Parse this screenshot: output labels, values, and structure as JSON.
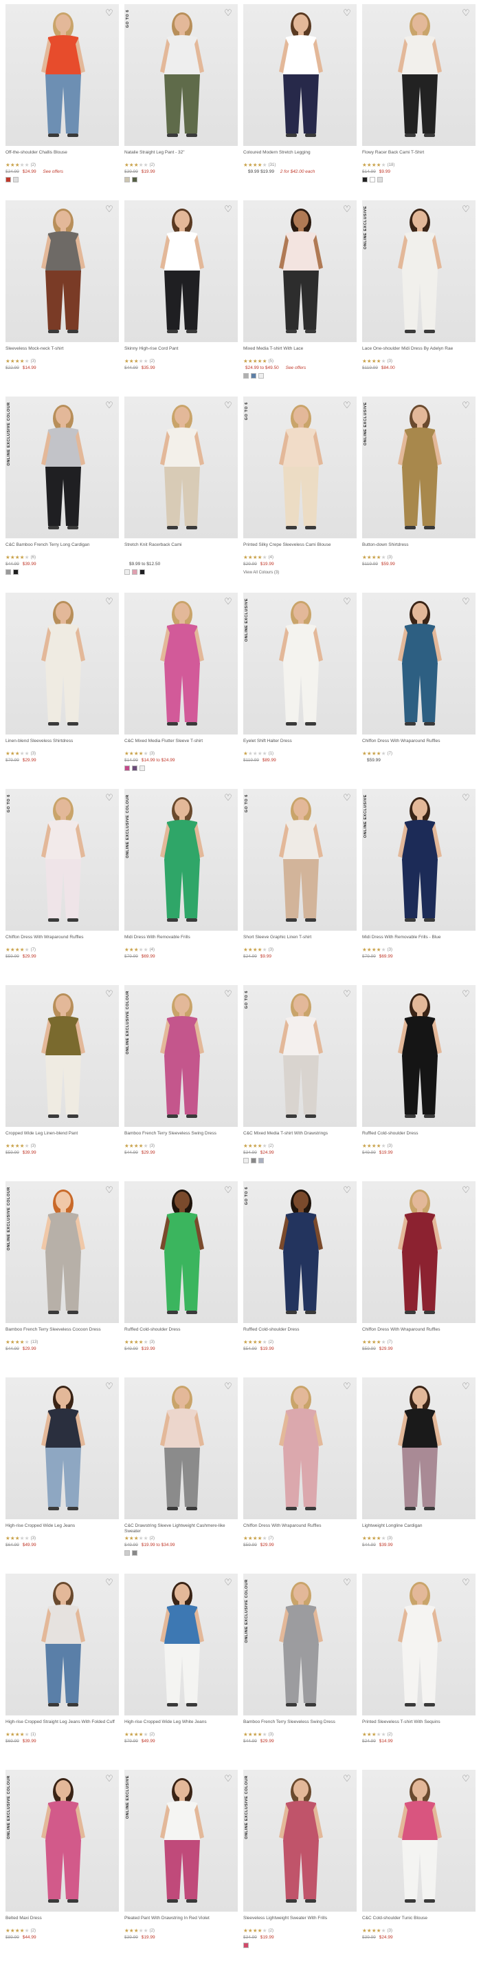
{
  "products": [
    {
      "name": "Off-the-shoulder Challis Blouse",
      "rating": 3,
      "reviews": "(2)",
      "orig": "$34.99",
      "sale": "$24.99",
      "price": "",
      "offer": "See offers",
      "alt": "",
      "badge": "",
      "swatches": [
        "#c0392b",
        "#dddddd"
      ],
      "view_all": "",
      "figure": {
        "top": "#e74c2c",
        "bottom": "#6d8fb3",
        "hair": "#c9a46a",
        "skin": "#e3b899"
      }
    },
    {
      "name": "Natalie Straight Leg Pant - 32\"",
      "rating": 3,
      "reviews": "(2)",
      "orig": "$39.99",
      "sale": "$19.99",
      "price": "",
      "offer": "",
      "alt": "",
      "badge": "GO TO 6",
      "swatches": [
        "#ccc5b0",
        "#555f44"
      ],
      "view_all": "",
      "figure": {
        "top": "#eeeeee",
        "bottom": "#5f6b4a",
        "hair": "#b88f5a",
        "skin": "#e3b899"
      }
    },
    {
      "name": "Coloured Modern Stretch Legging",
      "rating": 4,
      "reviews": "(31)",
      "orig": "",
      "sale": "",
      "price": "$9.99 $19.99",
      "offer": "",
      "alt": "2 for $42.00 each",
      "badge": "",
      "swatches": [],
      "view_all": "",
      "figure": {
        "top": "#ffffff",
        "bottom": "#27294a",
        "hair": "#5a3a22",
        "skin": "#e3b899"
      }
    },
    {
      "name": "Flowy Racer Back Cami T-Shirt",
      "rating": 4,
      "reviews": "(18)",
      "orig": "$14.99",
      "sale": "$9.99",
      "price": "",
      "offer": "",
      "alt": "",
      "badge": "",
      "swatches": [
        "#222222",
        "#ffffff",
        "#dddddd"
      ],
      "view_all": "",
      "figure": {
        "top": "#f2f0ec",
        "bottom": "#222222",
        "hair": "#c9a46a",
        "skin": "#e3b899"
      }
    },
    {
      "name": "Sleeveless Mock-neck T-shirt",
      "rating": 4,
      "reviews": "(3)",
      "orig": "$22.99",
      "sale": "$14.99",
      "price": "",
      "offer": "",
      "alt": "",
      "badge": "",
      "swatches": [],
      "view_all": "",
      "figure": {
        "top": "#6e6a66",
        "bottom": "#7a3b26",
        "hair": "#b88f5a",
        "skin": "#e3b899"
      }
    },
    {
      "name": "Skinny High-rise Cord Pant",
      "rating": 3,
      "reviews": "(2)",
      "orig": "$44.99",
      "sale": "$35.99",
      "price": "",
      "offer": "",
      "alt": "",
      "badge": "",
      "swatches": [],
      "view_all": "",
      "figure": {
        "top": "#ffffff",
        "bottom": "#1f1f22",
        "hair": "#5a3a22",
        "skin": "#e3b899"
      }
    },
    {
      "name": "Mixed Media T-shirt With Lace",
      "rating": 5,
      "reviews": "(5)",
      "orig": "",
      "sale": "$24.99 to $49.50",
      "price": "",
      "offer": "See offers",
      "alt": "",
      "badge": "",
      "swatches": [
        "#b0b0b0",
        "#5d7fa6",
        "#eeeeee"
      ],
      "view_all": "",
      "figure": {
        "top": "#f3e4e0",
        "bottom": "#2d2d2d",
        "hair": "#2a1a10",
        "skin": "#b07a55"
      }
    },
    {
      "name": "Lace One-shoulder Midi Dress By Adelyn Rae",
      "rating": 4,
      "reviews": "(3)",
      "orig": "$119.99",
      "sale": "$84.00",
      "price": "",
      "offer": "",
      "alt": "",
      "badge": "ONLINE EXCLUSIVE",
      "swatches": [],
      "view_all": "",
      "figure": {
        "top": "#f1f0ec",
        "bottom": "#f1f0ec",
        "hair": "#3a2416",
        "skin": "#e3b899"
      }
    },
    {
      "name": "C&C Bamboo French Terry Long Cardigan",
      "rating": 4,
      "reviews": "(6)",
      "orig": "$44.99",
      "sale": "$39.99",
      "price": "",
      "offer": "",
      "alt": "",
      "badge": "ONLINE EXCLUSIVE COLOUR",
      "swatches": [
        "#9a9a9a",
        "#1f1f1f"
      ],
      "view_all": "",
      "figure": {
        "top": "#c2c3c8",
        "bottom": "#1f1f22",
        "hair": "#b88f5a",
        "skin": "#e3b899"
      }
    },
    {
      "name": "Stretch Knit Racerback Cami",
      "rating": 0,
      "reviews": "",
      "orig": "",
      "sale": "",
      "price": "$9.99 to $12.50",
      "offer": "",
      "alt": "",
      "badge": "",
      "swatches": [
        "#eeeeee",
        "#e0a0b0",
        "#1f1f22"
      ],
      "view_all": "",
      "figure": {
        "top": "#f3f0ea",
        "bottom": "#d8cbb6",
        "hair": "#c9a46a",
        "skin": "#e3b899"
      }
    },
    {
      "name": "Printed Silky Crepe Sleeveless Cami Blouse",
      "rating": 4,
      "reviews": "(4)",
      "orig": "$29.99",
      "sale": "$19.99",
      "price": "",
      "offer": "",
      "alt": "",
      "badge": "GO TO 6",
      "swatches": [],
      "view_all": "View All Colours (3)",
      "figure": {
        "top": "#f1dcc8",
        "bottom": "#ecdcc4",
        "hair": "#c9a46a",
        "skin": "#e3b899"
      }
    },
    {
      "name": "Button-down Shirtdress",
      "rating": 4,
      "reviews": "(3)",
      "orig": "$119.99",
      "sale": "$59.99",
      "price": "",
      "offer": "",
      "alt": "",
      "badge": "ONLINE EXCLUSIVE",
      "swatches": [],
      "view_all": "",
      "figure": {
        "top": "#a8884c",
        "bottom": "#a8884c",
        "hair": "#6a4a2e",
        "skin": "#e3b899"
      }
    },
    {
      "name": "Linen-blend Sleeveless Shirtdress",
      "rating": 3,
      "reviews": "(3)",
      "orig": "$79.99",
      "sale": "$29.99",
      "price": "",
      "offer": "",
      "alt": "",
      "badge": "",
      "swatches": [],
      "view_all": "",
      "figure": {
        "top": "#efebe2",
        "bottom": "#efebe2",
        "hair": "#b88f5a",
        "skin": "#e3b899"
      }
    },
    {
      "name": "C&C Mixed Media Flutter Sleeve T-shirt",
      "rating": 4,
      "reviews": "(3)",
      "orig": "$14.99",
      "sale": "$14.99 to $24.99",
      "price": "",
      "offer": "",
      "alt": "",
      "badge": "",
      "swatches": [
        "#c24a8a",
        "#6a4d7a",
        "#eeeeee"
      ],
      "view_all": "",
      "figure": {
        "top": "#d25a99",
        "bottom": "#d25a99",
        "hair": "#c9a46a",
        "skin": "#e3b899"
      }
    },
    {
      "name": "Eyelet Shift Halter Dress",
      "rating": 1,
      "reviews": "(1)",
      "orig": "$119.99",
      "sale": "$89.99",
      "price": "",
      "offer": "",
      "alt": "",
      "badge": "ONLINE EXCLUSIVE",
      "swatches": [],
      "view_all": "",
      "figure": {
        "top": "#f4f3ef",
        "bottom": "#f4f3ef",
        "hair": "#c9a46a",
        "skin": "#e3b899"
      }
    },
    {
      "name": "Chiffon Dress With Wraparound Ruffles",
      "rating": 4,
      "reviews": "(7)",
      "orig": "",
      "sale": "",
      "price": "$59.99",
      "offer": "",
      "alt": "",
      "badge": "",
      "swatches": [],
      "view_all": "",
      "figure": {
        "top": "#2d5f82",
        "bottom": "#2d5f82",
        "hair": "#3a2416",
        "skin": "#e3b899"
      }
    },
    {
      "name": "Chiffon Dress With Wraparound Ruffles",
      "rating": 4,
      "reviews": "(7)",
      "orig": "$59.99",
      "sale": "$29.99",
      "price": "",
      "offer": "",
      "alt": "",
      "badge": "GO TO 6",
      "swatches": [],
      "view_all": "",
      "figure": {
        "top": "#f2eaea",
        "bottom": "#efe4e8",
        "hair": "#c9a46a",
        "skin": "#e3b899"
      }
    },
    {
      "name": "Midi Dress With Removable Frills",
      "rating": 3,
      "reviews": "(4)",
      "orig": "$79.99",
      "sale": "$69.99",
      "price": "",
      "offer": "",
      "alt": "",
      "badge": "ONLINE EXCLUSIVE COLOUR",
      "swatches": [],
      "view_all": "",
      "figure": {
        "top": "#2fa668",
        "bottom": "#2fa668",
        "hair": "#6a4a2e",
        "skin": "#e3b899"
      }
    },
    {
      "name": "Short Sleeve Graphic Linen T-shirt",
      "rating": 4,
      "reviews": "(3)",
      "orig": "$24.99",
      "sale": "$9.99",
      "price": "",
      "offer": "",
      "alt": "",
      "badge": "GO TO 6",
      "swatches": [],
      "view_all": "",
      "figure": {
        "top": "#efebe6",
        "bottom": "#d2b49a",
        "hair": "#c9a46a",
        "skin": "#e3b899"
      }
    },
    {
      "name": "Midi Dress With Removable Frills - Blue",
      "rating": 4,
      "reviews": "(3)",
      "orig": "$79.99",
      "sale": "$69.99",
      "price": "",
      "offer": "",
      "alt": "",
      "badge": "ONLINE EXCLUSIVE",
      "swatches": [],
      "view_all": "",
      "figure": {
        "top": "#1c2b57",
        "bottom": "#1c2b57",
        "hair": "#3a2416",
        "skin": "#e3b899"
      }
    },
    {
      "name": "Cropped Wide Leg Linen-blend Pant",
      "rating": 4,
      "reviews": "(3)",
      "orig": "$59.99",
      "sale": "$39.99",
      "price": "",
      "offer": "",
      "alt": "",
      "badge": "",
      "swatches": [],
      "view_all": "",
      "figure": {
        "top": "#7a6a2e",
        "bottom": "#efebe2",
        "hair": "#b88f5a",
        "skin": "#e3b899"
      }
    },
    {
      "name": "Bamboo French Terry Sleeveless Swing Dress",
      "rating": 4,
      "reviews": "(3)",
      "orig": "$44.99",
      "sale": "$29.99",
      "price": "",
      "offer": "",
      "alt": "",
      "badge": "ONLINE EXCLUSIVE COLOUR",
      "swatches": [],
      "view_all": "",
      "figure": {
        "top": "#c4568c",
        "bottom": "#c4568c",
        "hair": "#c9a46a",
        "skin": "#e3b899"
      }
    },
    {
      "name": "C&C Mixed Media T-shirt With Drawstrings",
      "rating": 4,
      "reviews": "(2)",
      "orig": "$34.99",
      "sale": "$24.99",
      "price": "",
      "offer": "",
      "alt": "",
      "badge": "GO TO 6",
      "swatches": [
        "#eeeeee",
        "#888888",
        "#aab0c0"
      ],
      "view_all": "",
      "figure": {
        "top": "#f4f0ee",
        "bottom": "#d9d4cf",
        "hair": "#c9a46a",
        "skin": "#e3b899"
      }
    },
    {
      "name": "Ruffled Cold-shoulder Dress",
      "rating": 4,
      "reviews": "(3)",
      "orig": "$49.99",
      "sale": "$19.99",
      "price": "",
      "offer": "",
      "alt": "",
      "badge": "",
      "swatches": [],
      "view_all": "",
      "figure": {
        "top": "#151515",
        "bottom": "#151515",
        "hair": "#3a2416",
        "skin": "#e3b899"
      }
    },
    {
      "name": "Bamboo French Terry Sleeveless Cocoon Dress",
      "rating": 4,
      "reviews": "(13)",
      "orig": "$44.99",
      "sale": "$29.99",
      "price": "",
      "offer": "",
      "alt": "",
      "badge": "ONLINE EXCLUSIVE COLOUR",
      "swatches": [],
      "view_all": "",
      "figure": {
        "top": "#b7b0a8",
        "bottom": "#b7b0a8",
        "hair": "#c96a2a",
        "skin": "#f0c8a8"
      }
    },
    {
      "name": "Ruffled Cold-shoulder Dress",
      "rating": 4,
      "reviews": "(3)",
      "orig": "$49.99",
      "sale": "$19.99",
      "price": "",
      "offer": "",
      "alt": "",
      "badge": "",
      "swatches": [],
      "view_all": "",
      "figure": {
        "top": "#3bb55e",
        "bottom": "#3bb55e",
        "hair": "#1f140c",
        "skin": "#7a4a2c"
      }
    },
    {
      "name": "Ruffled Cold-shoulder Dress",
      "rating": 4,
      "reviews": "(2)",
      "orig": "$54.99",
      "sale": "$19.99",
      "price": "",
      "offer": "",
      "alt": "",
      "badge": "GO TO 6",
      "swatches": [],
      "view_all": "",
      "figure": {
        "top": "#23345e",
        "bottom": "#23345e",
        "hair": "#1f140c",
        "skin": "#7a4a2c"
      }
    },
    {
      "name": "Chiffon Dress With Wraparound Ruffles",
      "rating": 4,
      "reviews": "(7)",
      "orig": "$59.99",
      "sale": "$29.99",
      "price": "",
      "offer": "",
      "alt": "",
      "badge": "",
      "swatches": [],
      "view_all": "",
      "figure": {
        "top": "#8c2230",
        "bottom": "#8c2230",
        "hair": "#c9a46a",
        "skin": "#e3b899"
      }
    },
    {
      "name": "High-rise Cropped Wide Leg Jeans",
      "rating": 3,
      "reviews": "(3)",
      "orig": "$64.99",
      "sale": "$49.99",
      "price": "",
      "offer": "",
      "alt": "",
      "badge": "",
      "swatches": [],
      "view_all": "",
      "figure": {
        "top": "#2a2f3e",
        "bottom": "#8ea7c2",
        "hair": "#3a2416",
        "skin": "#e3b899"
      }
    },
    {
      "name": "C&C Drawstring Sleeve Lightweight Cashmere-like Sweater",
      "rating": 3,
      "reviews": "(2)",
      "orig": "$49.99",
      "sale": "$19.99 to $34.99",
      "price": "",
      "offer": "",
      "alt": "",
      "badge": "",
      "swatches": [
        "#cccccc",
        "#888888"
      ],
      "view_all": "",
      "figure": {
        "top": "#ecd6cc",
        "bottom": "#8b8b8b",
        "hair": "#c9a46a",
        "skin": "#e3b899"
      }
    },
    {
      "name": "Chiffon Dress With Wraparound Ruffles",
      "rating": 4,
      "reviews": "(7)",
      "orig": "$59.99",
      "sale": "$29.99",
      "price": "",
      "offer": "",
      "alt": "",
      "badge": "",
      "swatches": [],
      "view_all": "",
      "figure": {
        "top": "#dba8ad",
        "bottom": "#dba8ad",
        "hair": "#c9a46a",
        "skin": "#e3b899"
      }
    },
    {
      "name": "Lightweight Longline Cardigan",
      "rating": 4,
      "reviews": "(3)",
      "orig": "$44.99",
      "sale": "$39.99",
      "price": "",
      "offer": "",
      "alt": "",
      "badge": "",
      "swatches": [],
      "view_all": "",
      "figure": {
        "top": "#1a1a1a",
        "bottom": "#a98a95",
        "hair": "#3a2416",
        "skin": "#e3b899"
      }
    },
    {
      "name": "High-rise Cropped Straight Leg Jeans With Folded Cuff",
      "rating": 4,
      "reviews": "(1)",
      "orig": "$69.99",
      "sale": "$39.99",
      "price": "",
      "offer": "",
      "alt": "",
      "badge": "",
      "swatches": [],
      "view_all": "",
      "figure": {
        "top": "#e6e2df",
        "bottom": "#5a7fa8",
        "hair": "#6a4a2e",
        "skin": "#e3b899"
      }
    },
    {
      "name": "High-rise Cropped Wide Leg White Jeans",
      "rating": 4,
      "reviews": "(2)",
      "orig": "$79.99",
      "sale": "$49.99",
      "price": "",
      "offer": "",
      "alt": "",
      "badge": "",
      "swatches": [],
      "view_all": "",
      "figure": {
        "top": "#3d78b3",
        "bottom": "#f4f4f2",
        "hair": "#3a2416",
        "skin": "#e3b899"
      }
    },
    {
      "name": "Bamboo French Terry Sleeveless Swing Dress",
      "rating": 4,
      "reviews": "(3)",
      "orig": "$44.99",
      "sale": "$29.99",
      "price": "",
      "offer": "",
      "alt": "",
      "badge": "ONLINE EXCLUSIVE COLOUR",
      "swatches": [],
      "view_all": "",
      "figure": {
        "top": "#9c9c9f",
        "bottom": "#9c9c9f",
        "hair": "#c9a46a",
        "skin": "#e3b899"
      }
    },
    {
      "name": "Printed Sleeveless T-shirt With Sequins",
      "rating": 3,
      "reviews": "(2)",
      "orig": "$24.99",
      "sale": "$14.99",
      "price": "",
      "offer": "",
      "alt": "",
      "badge": "",
      "swatches": [],
      "view_all": "",
      "figure": {
        "top": "#f5f4f2",
        "bottom": "#f5f4f2",
        "hair": "#c9a46a",
        "skin": "#e3b899"
      }
    },
    {
      "name": "Belted Maxi Dress",
      "rating": 4,
      "reviews": "(2)",
      "orig": "$89.99",
      "sale": "$44.99",
      "price": "",
      "offer": "",
      "alt": "",
      "badge": "ONLINE EXCLUSIVE COLOUR",
      "swatches": [],
      "view_all": "",
      "figure": {
        "top": "#d25a8a",
        "bottom": "#d25a8a",
        "hair": "#3a2416",
        "skin": "#e3b899"
      }
    },
    {
      "name": "Pleated Pant With Drawstring In Red Violet",
      "rating": 3,
      "reviews": "(2)",
      "orig": "$39.99",
      "sale": "$19.99",
      "price": "",
      "offer": "",
      "alt": "",
      "badge": "ONLINE EXCLUSIVE",
      "swatches": [],
      "view_all": "",
      "figure": {
        "top": "#f5f5f3",
        "bottom": "#c04a7a",
        "hair": "#3a2416",
        "skin": "#e3b899"
      }
    },
    {
      "name": "Sleeveless Lightweight Sweater With Frills",
      "rating": 4,
      "reviews": "(2)",
      "orig": "$34.99",
      "sale": "$19.99",
      "price": "",
      "offer": "",
      "alt": "",
      "badge": "ONLINE EXCLUSIVE COLOUR",
      "swatches": [
        "#d14a6a"
      ],
      "view_all": "",
      "figure": {
        "top": "#c0546a",
        "bottom": "#c0546a",
        "hair": "#6a4a2e",
        "skin": "#e3b899"
      }
    },
    {
      "name": "C&C Cold-shoulder Tunic Blouse",
      "rating": 4,
      "reviews": "(3)",
      "orig": "$39.99",
      "sale": "$24.99",
      "price": "",
      "offer": "",
      "alt": "",
      "badge": "",
      "swatches": [],
      "view_all": "",
      "figure": {
        "top": "#d9557f",
        "bottom": "#f4f4f2",
        "hair": "#6a4a2e",
        "skin": "#e3b899"
      }
    }
  ],
  "icons": {
    "wishlist": "heart-outline-icon",
    "star": "star-icon"
  },
  "colors": {
    "sale_price": "#c0392b",
    "star": "#c9a24a",
    "regular_price": "#999999"
  }
}
